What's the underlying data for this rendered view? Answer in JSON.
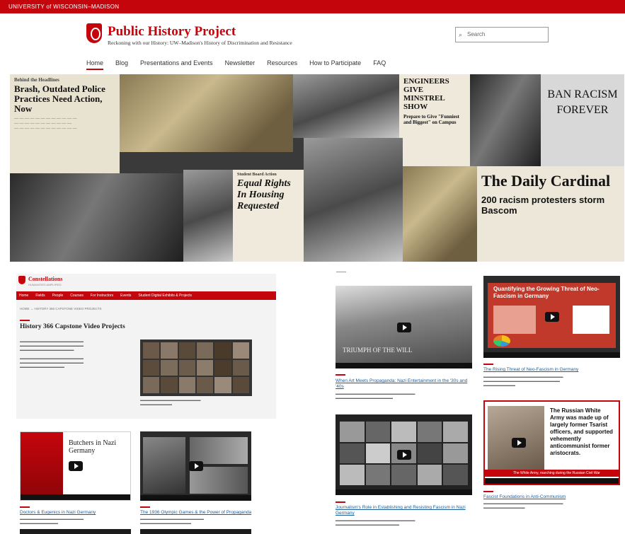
{
  "topbar": {
    "university": "UNIVERSITY of WISCONSIN–MADISON"
  },
  "header": {
    "title": "Public History Project",
    "tagline": "Reckoning with our History: UW–Madison's History of Discrimination and Resistance",
    "search_placeholder": "Search"
  },
  "nav": {
    "items": [
      "Home",
      "Blog",
      "Presentations and Events",
      "Newsletter",
      "Resources",
      "How to Participate",
      "FAQ"
    ]
  },
  "hero": {
    "clip1_headline": "Brash, Outdated Police Practices Need Action, Now",
    "clip1_top": "Behind the Headlines",
    "clip2_headline": "ENGINEERS GIVE MINSTREL SHOW",
    "clip2_sub": "Prepare to Give \"Funniest and Biggest\" on Campus",
    "clip3_headline": "Equal Rights In Housing Requested",
    "clip3_top": "Student Board Action",
    "sign_text": "BAN RACISM FOREVER",
    "cardinal": "The Daily Cardinal",
    "cardinal_headline": "200 racism protesters storm Bascom"
  },
  "constellations": {
    "logo": "Constellations",
    "logo_sub": "HUMANITIES AMPLIFIED",
    "nav": [
      "Home",
      "Fields",
      "People",
      "Courses",
      "For Instructors",
      "Events",
      "Student Digital Exhibits & Projects"
    ],
    "breadcrumb": "HOME → HISTORY 366 CAPSTONE VIDEO PROJECTS",
    "page_title": "History 366 Capstone Video Projects",
    "video1_title": "Butchers in Nazi Germany",
    "caption1": "Doctors & Eugenics in Nazi Germany",
    "caption2": "The 1936 Olympic Games & the Power of Propaganda"
  },
  "videos_right": {
    "v1_overlay": "TRIUMPH OF THE WILL",
    "caption1": "When Art Meets Propaganda: Nazi Entertainment in the '30s and '40s",
    "v2_title": "Quantifying the Growing Threat of Neo-Fascism in Germany",
    "caption2": "The Rising Threat of Neo-Fascism in Germany",
    "caption3": "Journalism's Role in Establishing and Resisting Fascism in Nazi Germany",
    "v4_text": "The Russian White Army was made up of largely former Tsarist officers, and supported vehemently anticommunist former aristocrats.",
    "v4_caption_inner": "The White Army, marching during the Russian Civil War",
    "caption4": "Fascist Foundations in Anti-Communism"
  }
}
